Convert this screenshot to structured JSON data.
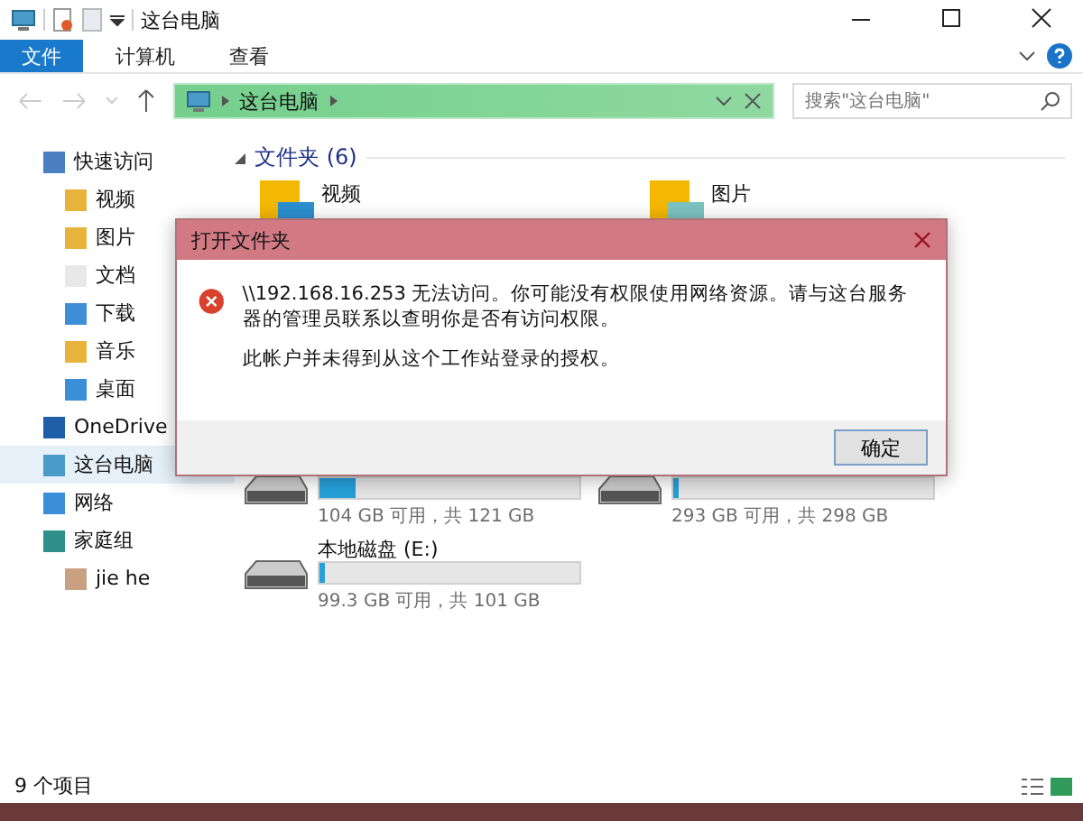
{
  "window": {
    "title": "这台电脑"
  },
  "ribbon_tabs": [
    {
      "label": "文件",
      "selected": true
    },
    {
      "label": "计算机",
      "selected": false
    },
    {
      "label": "查看",
      "selected": false
    }
  ],
  "address": {
    "path": "这台电脑"
  },
  "search": {
    "placeholder": "搜索\"这台电脑\""
  },
  "sidebar": {
    "items": [
      {
        "label": "快速访问",
        "selected": false,
        "children": [
          {
            "label": "视频"
          },
          {
            "label": "图片"
          },
          {
            "label": "文档"
          },
          {
            "label": "下载"
          },
          {
            "label": "音乐"
          },
          {
            "label": "桌面"
          }
        ]
      },
      {
        "label": "OneDrive",
        "selected": false
      },
      {
        "label": "这台电脑",
        "selected": true
      },
      {
        "label": "网络",
        "selected": false
      },
      {
        "label": "家庭组",
        "selected": false,
        "children": [
          {
            "label": "jie he"
          }
        ]
      }
    ]
  },
  "folders": {
    "header": "文件夹 (6)",
    "items": [
      {
        "label": "视频"
      },
      {
        "label": "图片"
      }
    ]
  },
  "drives": [
    {
      "level": 0.14,
      "reading": "104 GB 可用，共 121 GB"
    },
    {
      "level": 0.02,
      "reading": "293 GB 可用，共 298 GB"
    },
    {
      "name": "本地磁盘 (E:)",
      "level": 0.02,
      "reading": "99.3 GB 可用，共 101 GB"
    }
  ],
  "dialog": {
    "title": "打开文件夹",
    "message": "\\\\192.168.16.253 无法访问。你可能没有权限使用网络资源。请与这台服务器的管理员联系以查明你是否有访问权限。",
    "detail": "此帐户并未得到从这个工作站登录的授权。",
    "button": "确定"
  },
  "status_bar": {
    "count": "9 个项目"
  }
}
